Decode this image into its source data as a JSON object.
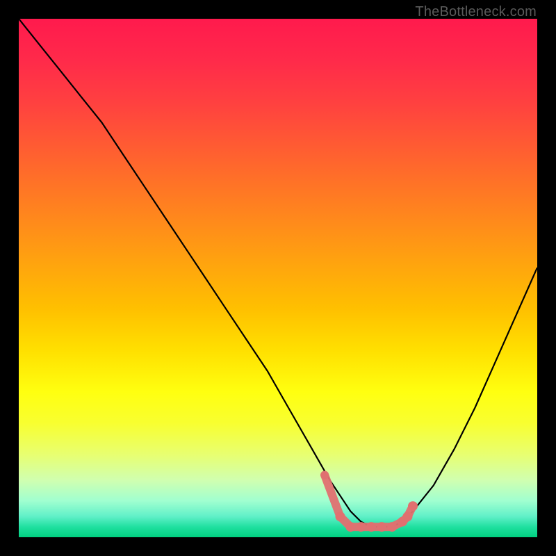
{
  "watermark": "TheBottleneck.com",
  "colors": {
    "gradient_top": "#ff1a4d",
    "gradient_bottom": "#00d080",
    "curve": "#000000",
    "marker": "#e07070"
  },
  "chart_data": {
    "type": "line",
    "title": "",
    "xlabel": "",
    "ylabel": "",
    "xlim": [
      0,
      100
    ],
    "ylim": [
      0,
      100
    ],
    "series": [
      {
        "name": "bottleneck-curve",
        "x": [
          0,
          4,
          8,
          12,
          16,
          20,
          24,
          28,
          32,
          36,
          40,
          44,
          48,
          52,
          56,
          60,
          62,
          64,
          66,
          68,
          70,
          72,
          74,
          76,
          80,
          84,
          88,
          92,
          96,
          100
        ],
        "y": [
          100,
          95,
          90,
          85,
          80,
          74,
          68,
          62,
          56,
          50,
          44,
          38,
          32,
          25,
          18,
          11,
          8,
          5,
          3,
          2,
          2,
          2,
          3,
          5,
          10,
          17,
          25,
          34,
          43,
          52
        ]
      }
    ],
    "markers": {
      "name": "highlight-points",
      "color": "#e07070",
      "x": [
        59,
        62,
        64,
        66,
        68,
        70,
        72,
        74,
        75,
        76
      ],
      "y": [
        12,
        4,
        2,
        2,
        2,
        2,
        2,
        3,
        4,
        6
      ]
    }
  }
}
